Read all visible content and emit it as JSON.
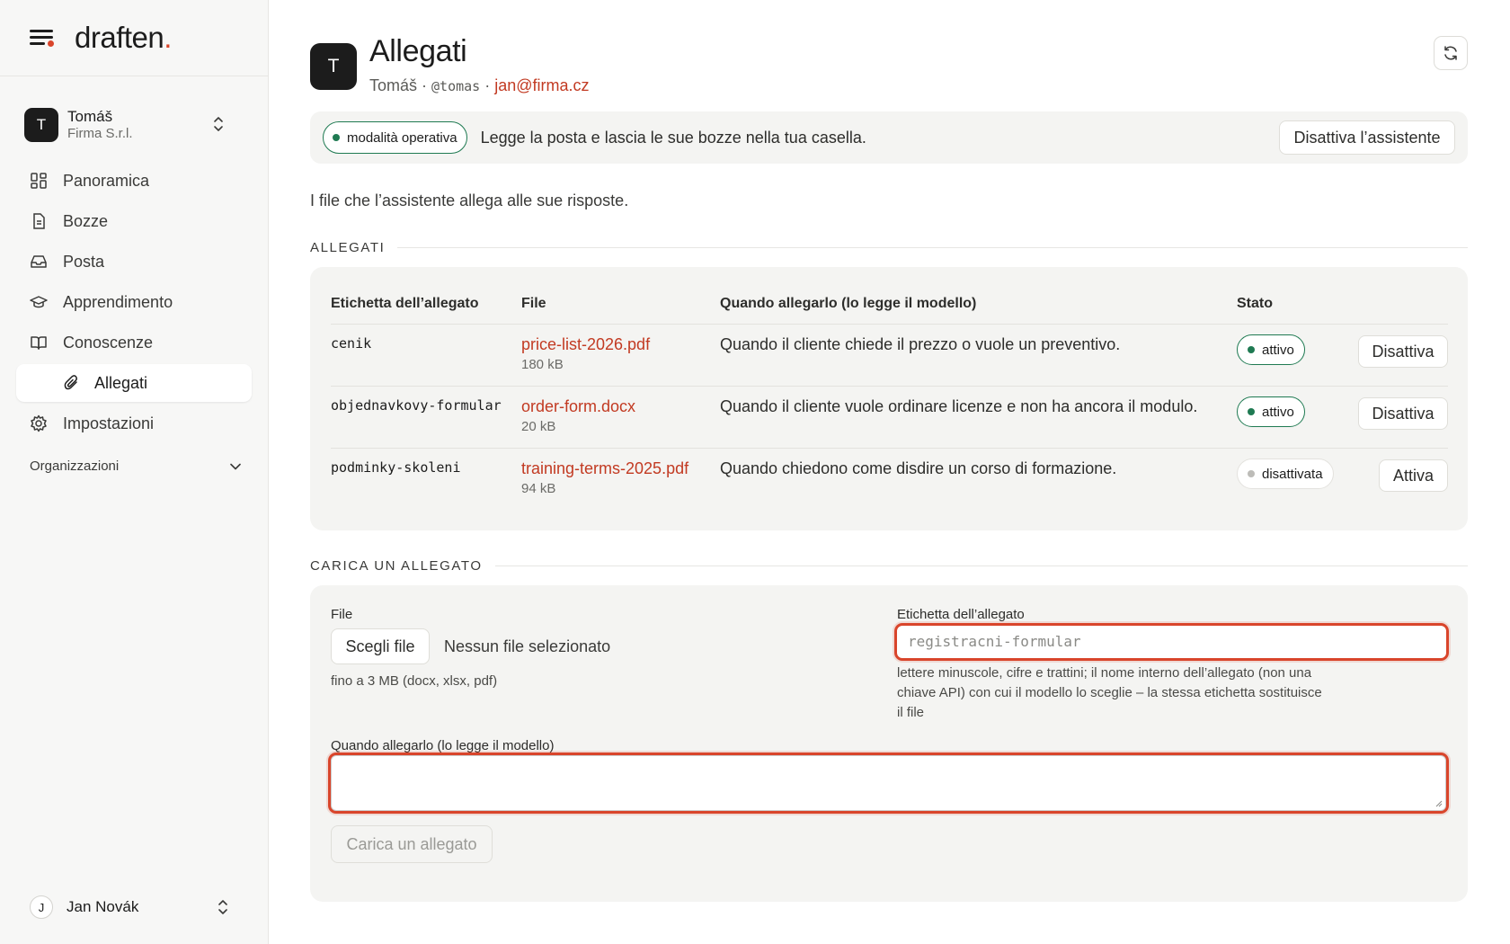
{
  "brand": {
    "name": "draften",
    "dot": "."
  },
  "account": {
    "initial": "T",
    "name": "Tomáš",
    "org": "Firma S.r.l."
  },
  "nav": {
    "items": [
      {
        "label": "Panoramica",
        "icon": "dashboard-icon"
      },
      {
        "label": "Bozze",
        "icon": "document-icon"
      },
      {
        "label": "Posta",
        "icon": "inbox-icon"
      },
      {
        "label": "Apprendimento",
        "icon": "graduation-cap-icon"
      },
      {
        "label": "Conoscenze",
        "icon": "book-icon"
      },
      {
        "label": "Allegati",
        "icon": "paperclip-icon",
        "active": true
      },
      {
        "label": "Impostazioni",
        "icon": "gear-icon"
      }
    ],
    "section": "Organizzazioni"
  },
  "user": {
    "initial": "J",
    "name": "Jan Novák"
  },
  "header": {
    "initial": "T",
    "title": "Allegati",
    "name": "Tomáš",
    "sep1": " · ",
    "handle": "@tomas",
    "sep2": " · ",
    "email": "jan@firma.cz"
  },
  "banner": {
    "mode": "modalità operativa",
    "text": "Legge la posta e lascia le sue bozze nella tua casella.",
    "button": "Disattiva l’assistente"
  },
  "intro": "I file che l’assistente allega alle sue risposte.",
  "attachments": {
    "section_label": "ALLEGATI",
    "columns": [
      "Etichetta dell’allegato",
      "File",
      "Quando allegarlo (lo legge il modello)",
      "Stato"
    ],
    "rows": [
      {
        "label": "cenik",
        "file": "price-list-2026.pdf",
        "size": "180 kB",
        "when": "Quando il cliente chiede il prezzo o vuole un preventivo.",
        "status": "attivo",
        "action": "Disattiva"
      },
      {
        "label": "objednavkovy-formular",
        "file": "order-form.docx",
        "size": "20 kB",
        "when": "Quando il cliente vuole ordinare licenze e non ha ancora il modulo.",
        "status": "attivo",
        "action": "Disattiva"
      },
      {
        "label": "podminky-skoleni",
        "file": "training-terms-2025.pdf",
        "size": "94 kB",
        "when": "Quando chiedono come disdire un corso di formazione.",
        "status": "disattivata",
        "action": "Attiva"
      }
    ]
  },
  "upload": {
    "section_label": "CARICA UN ALLEGATO",
    "file_label": "File",
    "file_button": "Scegli file",
    "file_none": "Nessun file selezionato",
    "file_hint": "fino a 3 MB (docx, xlsx, pdf)",
    "label_label": "Etichetta dell’allegato",
    "label_placeholder": "registracni-formular",
    "label_hint_1": "lettere minuscole, cifre e trattini; il nome interno dell’allegato (non una",
    "label_hint_2": "chiave API) con cui il modello lo sceglie – la stessa etichetta sostituisce",
    "label_hint_3": "il file",
    "when_label": "Quando allegarlo (lo legge il modello)",
    "submit": "Carica un allegato"
  },
  "colors": {
    "accent": "#d9452b",
    "active_green": "#1f7a52",
    "sidebar_bg": "#f7f7f6"
  }
}
